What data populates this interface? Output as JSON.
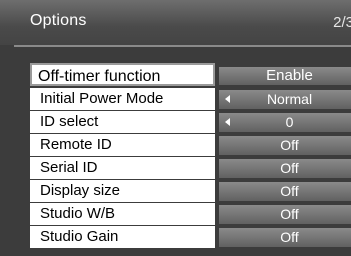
{
  "header": {
    "title": "Options",
    "page": "2/3"
  },
  "rows": [
    {
      "label": "Off-timer function",
      "value": "Enable",
      "left_arrow": false,
      "right_arrow": true
    },
    {
      "label": "Initial Power Mode",
      "value": "Normal",
      "left_arrow": true,
      "right_arrow": true
    },
    {
      "label": "ID select",
      "value": "0",
      "left_arrow": true,
      "right_arrow": true
    },
    {
      "label": "Remote ID",
      "value": "Off",
      "left_arrow": false,
      "right_arrow": true
    },
    {
      "label": "Serial ID",
      "value": "Off",
      "left_arrow": false,
      "right_arrow": true
    },
    {
      "label": "Display size",
      "value": "Off",
      "left_arrow": false,
      "right_arrow": true
    },
    {
      "label": "Studio W/B",
      "value": "Off",
      "left_arrow": false,
      "right_arrow": true
    },
    {
      "label": "Studio Gain",
      "value": "Off",
      "left_arrow": false,
      "right_arrow": true
    }
  ]
}
